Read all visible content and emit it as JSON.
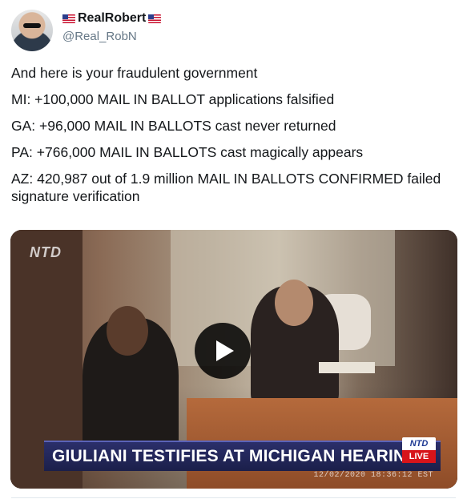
{
  "author": {
    "display_name": "RealRobert",
    "handle": "@Real_RobN",
    "avatar_icon": "user-avatar"
  },
  "tweet": {
    "lines": [
      "And here is your fraudulent government",
      "MI: +100,000 MAIL IN BALLOT applications falsified",
      "GA: +96,000 MAIL IN BALLOTS cast never returned",
      "PA: +766,000 MAIL IN BALLOTS cast magically appears",
      "AZ: 420,987 out of 1.9 million MAIL IN BALLOTS CONFIRMED failed signature verification"
    ]
  },
  "video": {
    "watermark": "NTD",
    "headline": "GIULIANI TESTIFIES AT MICHIGAN HEARING",
    "badge_network": "NTD",
    "badge_live": "LIVE",
    "timestamp": "12/02/2020 18:36:12 EST",
    "play_icon": "play-icon"
  },
  "colors": {
    "lower_third_bg": "#1b1f4a",
    "live_red": "#d7141a",
    "text_primary": "#14171a",
    "text_secondary": "#657786"
  }
}
